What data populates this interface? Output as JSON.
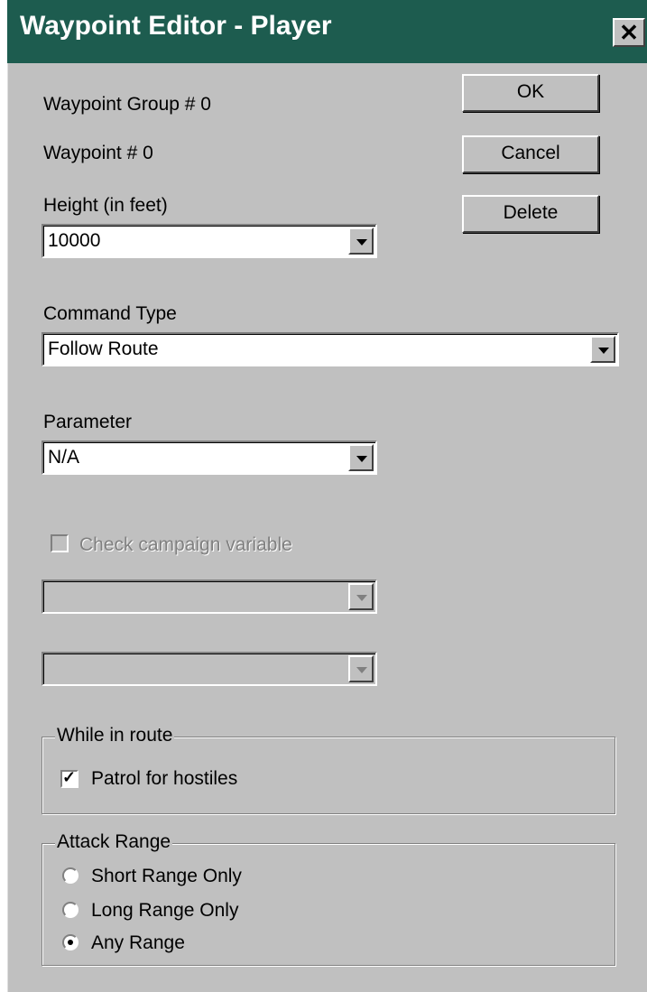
{
  "window": {
    "title": "Waypoint Editor - Player",
    "close_label": "✕"
  },
  "labels": {
    "group": "Waypoint Group # 0",
    "waypoint": "Waypoint # 0",
    "height": "Height (in feet)",
    "command_type": "Command Type",
    "parameter": "Parameter",
    "campaign_variable": "Check campaign variable"
  },
  "buttons": {
    "ok": "OK",
    "cancel": "Cancel",
    "delete": "Delete"
  },
  "fields": {
    "height_value": "10000",
    "command_type_value": "Follow Route",
    "parameter_value": "N/A",
    "campaign_var_1": "",
    "campaign_var_2": ""
  },
  "checks": {
    "campaign_variable_checked": false,
    "patrol_checked": true
  },
  "while_in_route": {
    "legend": "While in route",
    "patrol_label": "Patrol for hostiles"
  },
  "attack_range": {
    "legend": "Attack Range",
    "options": [
      "Short Range Only",
      "Long Range Only",
      "Any Range"
    ],
    "selected": "Any Range"
  },
  "colors": {
    "titlebar": "#1d5c4f",
    "face": "#c0c0c0"
  }
}
